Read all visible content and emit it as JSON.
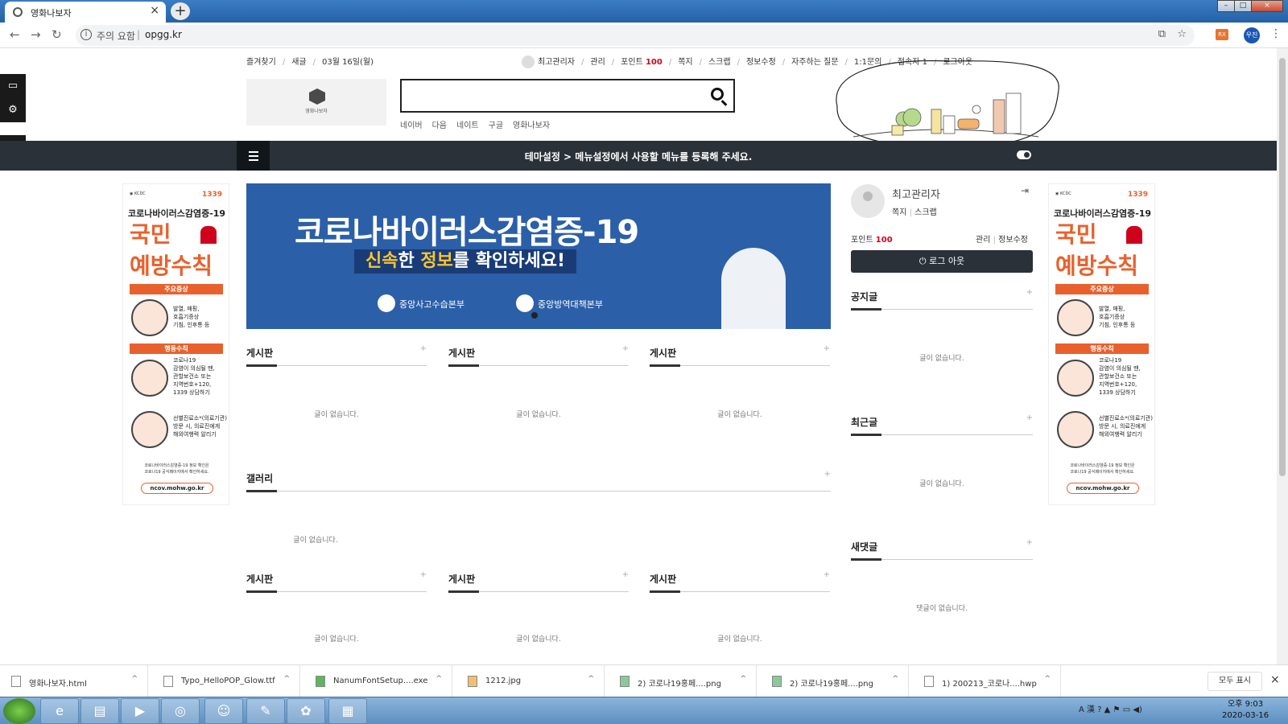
{
  "browser": {
    "tab_title": "영화나보자",
    "address_warning": "주의 요함",
    "address_url": "opgg.kr",
    "profile_initial": "우진",
    "extension_label": "RX"
  },
  "top_links": {
    "left": [
      "즐겨찾기",
      "새글",
      "03월 16일(월)"
    ],
    "user": "최고관리자",
    "admin": "관리",
    "point_label": "포인트",
    "point_value": "100",
    "right": [
      "쪽지",
      "스크랩",
      "정보수정",
      "자주하는 질문",
      "1:1문의",
      "접속자 1",
      "로그아웃"
    ]
  },
  "logo_text": "영화나보자",
  "search_links": [
    "네이버",
    "다음",
    "네이트",
    "구글",
    "영화나보자"
  ],
  "nav_message": "테마설정 > 메뉴설정에서 사용할 메뉴를 등록해 주세요.",
  "ad": {
    "title": "코로나바이러스감염증-19",
    "headline_1": "국민",
    "headline_2": "예방수칙",
    "symptom_label": "주요증상",
    "symptom_text": [
      "발열, 매핑,",
      "호흡기증상",
      "기침, 인후통 등"
    ],
    "action_label": "행동수칙",
    "action_text_1": [
      "코로나19",
      "감염이 의심될 땐,",
      "관할보건소 또는",
      "지역번호+120,",
      "1339 상담하기"
    ],
    "action_text_2": [
      "선별진료소*(의료기관)",
      "방문 시, 의료진에게",
      "해외여행력 알리기"
    ],
    "footer": [
      "코로나바이러스감염증-19 정보 확인은",
      "코로나19 공식페이지에서 확인하세요."
    ],
    "url": "ncov.mohw.go.kr",
    "hotline": "1339"
  },
  "banner": {
    "title": "코로나바이러스감염증-19",
    "sub_prefix": "",
    "sub_hl1": "신속",
    "sub_mid": "한 ",
    "sub_hl2": "정보",
    "sub_suffix": "를 확인하세요!",
    "org_1": "중앙사고수습본부",
    "org_2": "중앙방역대책본부"
  },
  "boards": {
    "row1": [
      {
        "title": "게시판",
        "empty": "글이 없습니다."
      },
      {
        "title": "게시판",
        "empty": "글이 없습니다."
      },
      {
        "title": "게시판",
        "empty": "글이 없습니다."
      }
    ],
    "gallery": {
      "title": "갤러리",
      "empty": "글이 없습니다."
    },
    "row2": [
      {
        "title": "게시판",
        "empty": "글이 없습니다."
      },
      {
        "title": "게시판",
        "empty": "글이 없습니다."
      },
      {
        "title": "게시판",
        "empty": "글이 없습니다."
      }
    ],
    "plus": "+"
  },
  "sidebar": {
    "user_name": "최고관리자",
    "memo": "쪽지",
    "scrap": "스크랩",
    "point_label": "포인트",
    "point_value": "100",
    "admin": "관리",
    "edit": "정보수정",
    "logout": "로그 아웃",
    "notice": {
      "title": "공지글",
      "empty": "글이 없습니다."
    },
    "recent": {
      "title": "최근글",
      "empty": "글이 없습니다."
    },
    "comments": {
      "title": "새댓글",
      "empty": "댓글이 없습니다."
    }
  },
  "downloads": [
    {
      "name": "영화나보자.html"
    },
    {
      "name": "Typo_HelloPOP_Glow.ttf"
    },
    {
      "name": "NanumFontSetup....exe"
    },
    {
      "name": "1212.jpg"
    },
    {
      "name": "2) 코로나19홍페....png"
    },
    {
      "name": "2) 코로나19홍페....png"
    },
    {
      "name": "1) 200213_코로나....hwp"
    }
  ],
  "downloads_show_all": "모두 표시",
  "taskbar": {
    "time": "오후 9:03",
    "date": "2020-03-16"
  },
  "colors": {
    "accent_red": "#d0021b",
    "nav_dark": "#2a3138",
    "banner_blue": "#2b5fa8",
    "ad_orange": "#e8612c"
  }
}
